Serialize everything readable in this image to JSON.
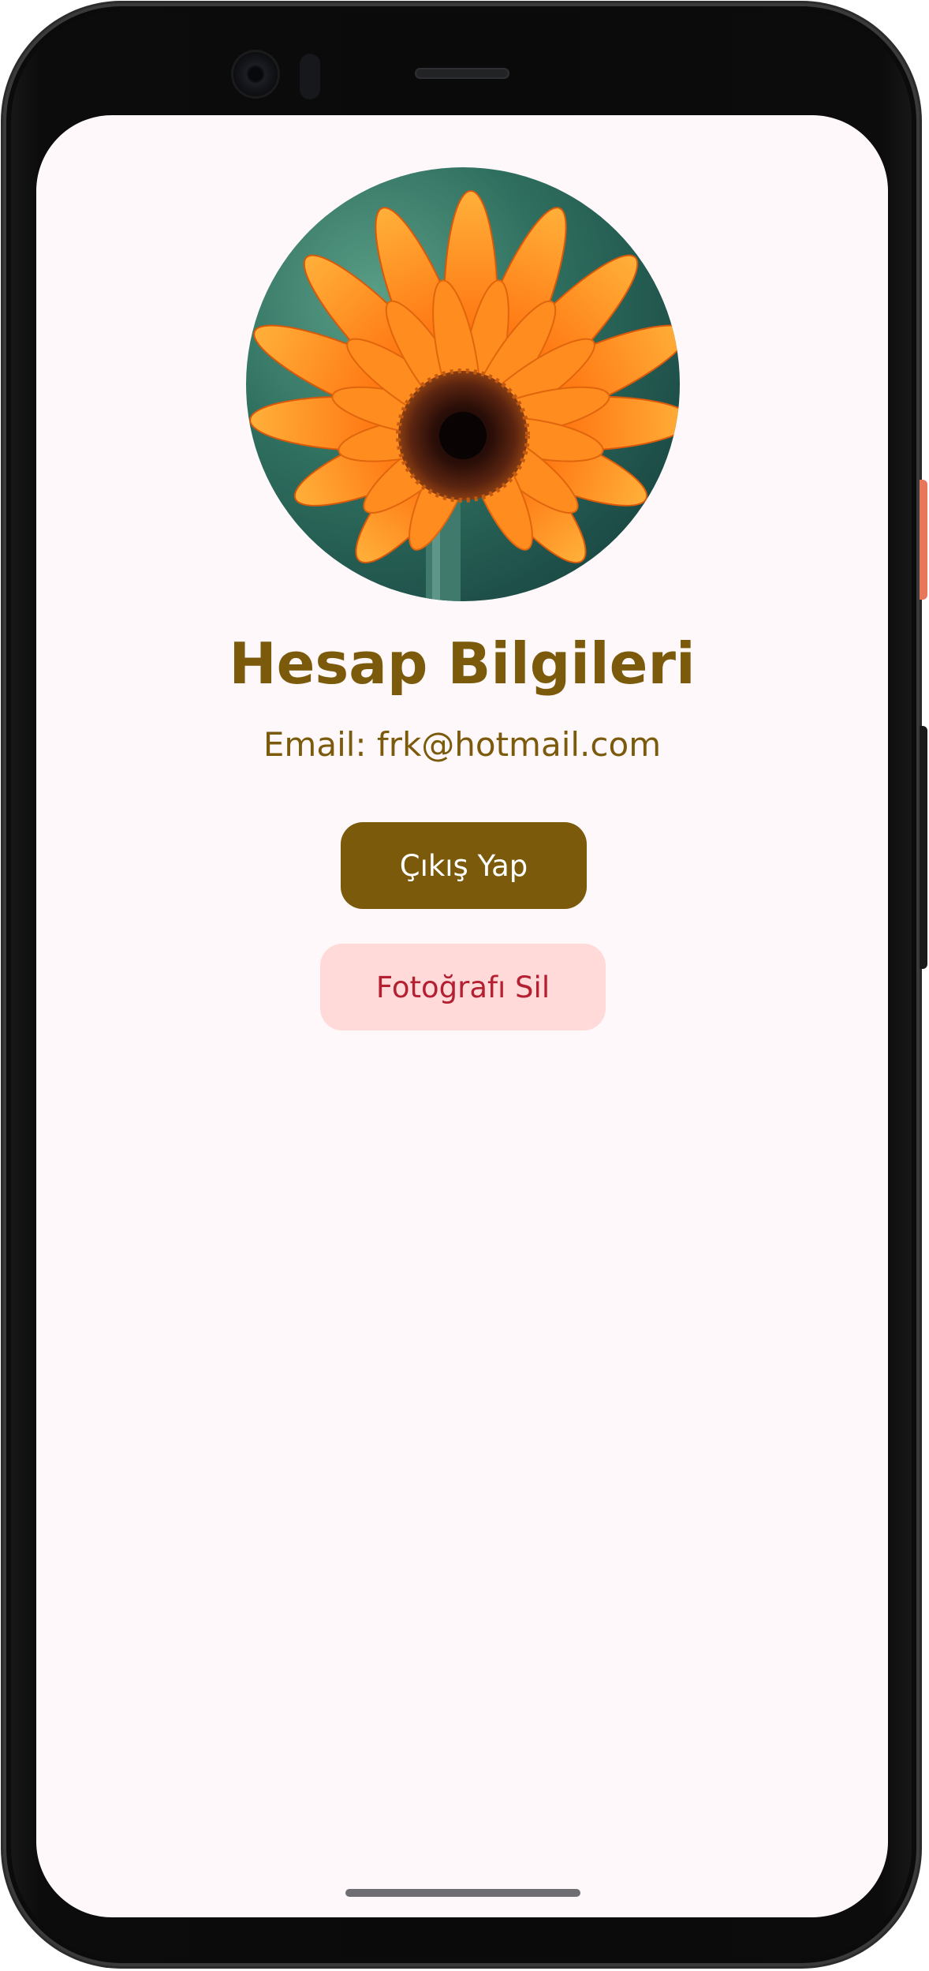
{
  "profile": {
    "avatar_alt": "Orange gerbera flower profile photo",
    "title": "Hesap Bilgileri",
    "email_text": "Email: frk@hotmail.com"
  },
  "actions": {
    "logout_label": "Çıkış Yap",
    "delete_photo_label": "Fotoğrafı Sil"
  },
  "colors": {
    "accent": "#7b5a0b",
    "background": "#fef8fb",
    "delete_bg": "#ffdad8",
    "delete_text": "#b42032"
  }
}
